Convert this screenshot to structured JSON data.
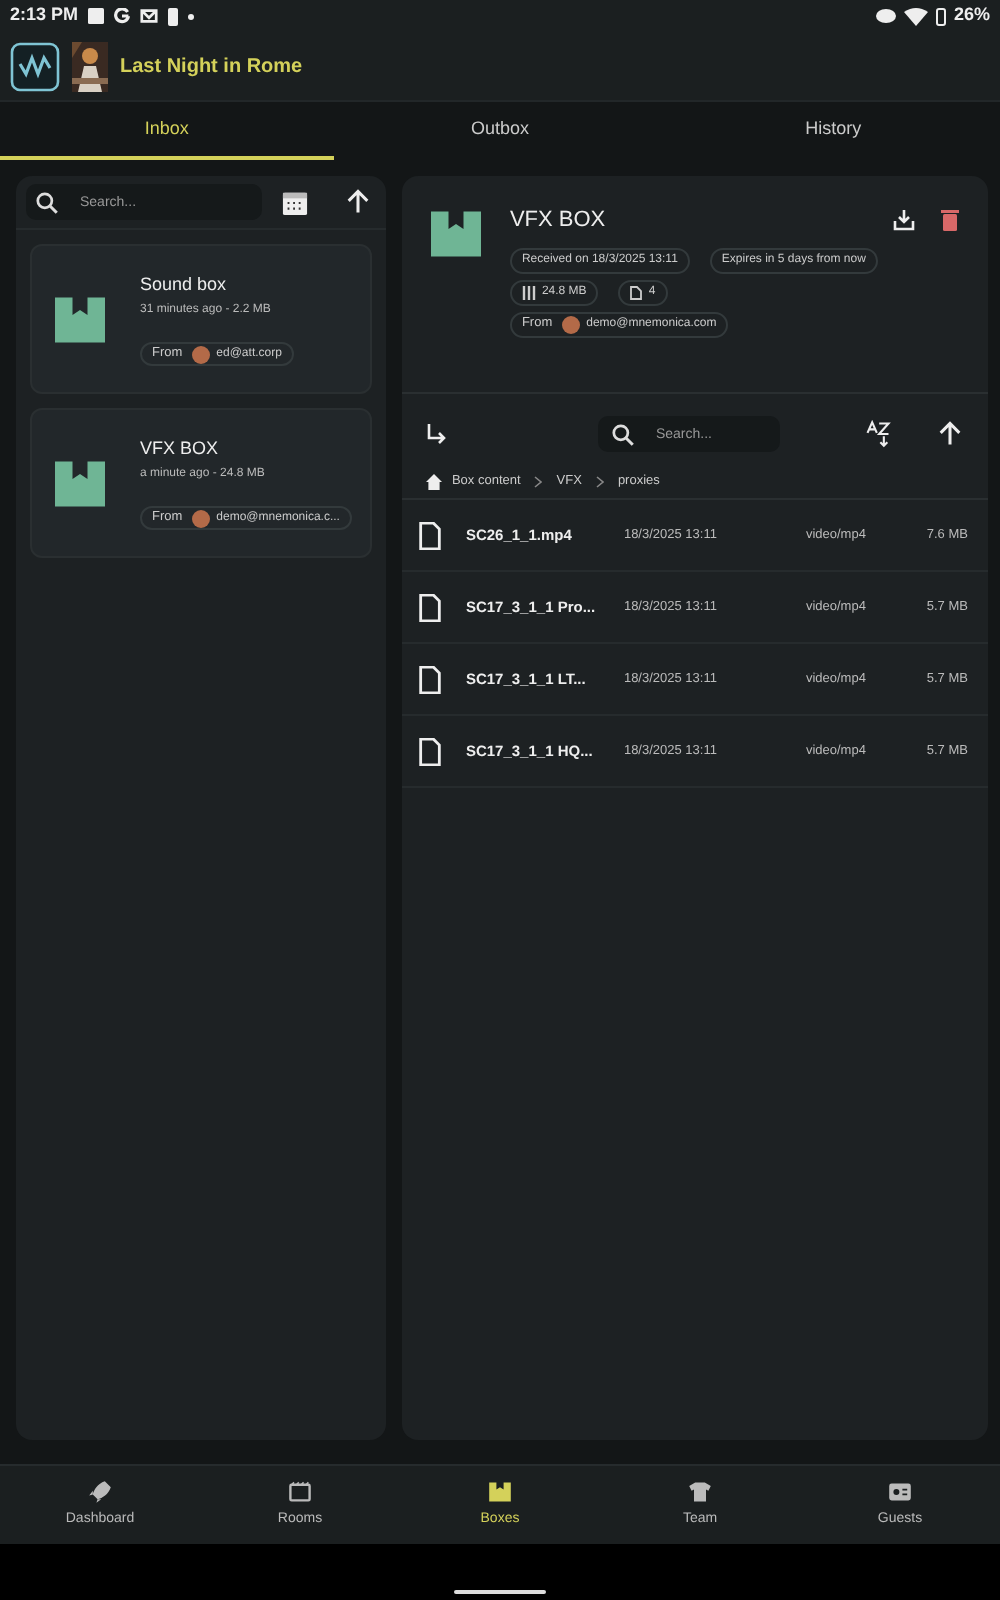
{
  "status_bar": {
    "time": "2:13 PM",
    "battery": "26%"
  },
  "header": {
    "title": "Last Night in Rome"
  },
  "tabs": [
    {
      "label": "Inbox",
      "selected": true
    },
    {
      "label": "Outbox",
      "selected": false
    },
    {
      "label": "History",
      "selected": false
    }
  ],
  "inbox": {
    "search_placeholder": "Search...",
    "boxes": [
      {
        "title": "Sound box",
        "meta": "31 minutes ago - 2.2 MB",
        "from_label": "From",
        "sender": "ed@att.corp"
      },
      {
        "title": "VFX BOX",
        "meta": "a minute ago - 24.8 MB",
        "from_label": "From",
        "sender": "demo@mnemonica.c..."
      }
    ]
  },
  "detail": {
    "title": "VFX BOX",
    "received": "Received on 18/3/2025 13:11",
    "expires": "Expires in 5 days from now",
    "size": "24.8 MB",
    "file_count": "4",
    "from_label": "From",
    "sender": "demo@mnemonica.com",
    "search_placeholder": "Search...",
    "breadcrumb": [
      "Box content",
      "VFX",
      "proxies"
    ],
    "files": [
      {
        "name": "SC26_1_1.mp4",
        "date": "18/3/2025 13:11",
        "type": "video/mp4",
        "size": "7.6 MB"
      },
      {
        "name": "SC17_3_1_1 Pro...",
        "date": "18/3/2025 13:11",
        "type": "video/mp4",
        "size": "5.7 MB"
      },
      {
        "name": "SC17_3_1_1 LT...",
        "date": "18/3/2025 13:11",
        "type": "video/mp4",
        "size": "5.7 MB"
      },
      {
        "name": "SC17_3_1_1 HQ...",
        "date": "18/3/2025 13:11",
        "type": "video/mp4",
        "size": "5.7 MB"
      }
    ]
  },
  "nav": [
    {
      "label": "Dashboard",
      "kind": "rocket",
      "selected": false
    },
    {
      "label": "Rooms",
      "kind": "rooms",
      "selected": false
    },
    {
      "label": "Boxes",
      "kind": "box",
      "selected": true
    },
    {
      "label": "Team",
      "kind": "shirt",
      "selected": false
    },
    {
      "label": "Guests",
      "kind": "card",
      "selected": false
    }
  ]
}
